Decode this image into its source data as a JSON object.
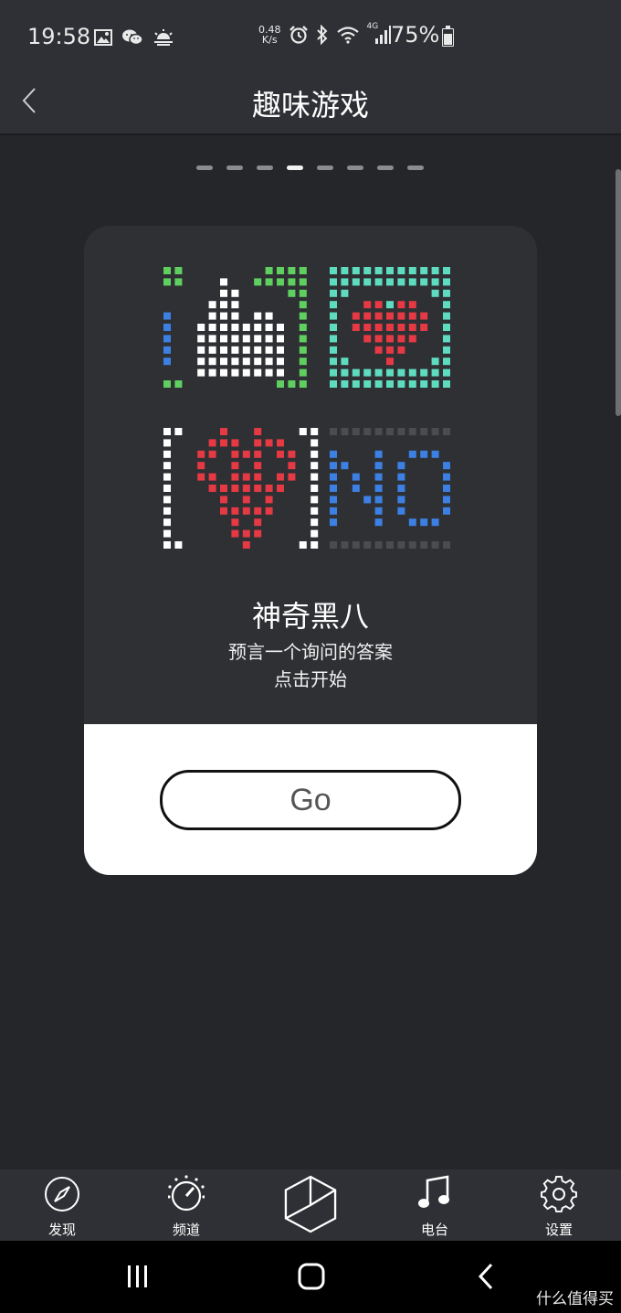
{
  "status_bar": {
    "time": "19:58",
    "net_speed_value": "0.48",
    "net_speed_unit": "K/s",
    "network_type": "4G",
    "battery": "75%",
    "left_icons": [
      "image-icon",
      "wechat-icon",
      "weather-icon"
    ],
    "right_icons": [
      "alarm-icon",
      "bluetooth-icon",
      "wifi-icon",
      "signal-icon",
      "battery-icon"
    ]
  },
  "header": {
    "title": "趣味游戏",
    "back_icon": "chevron-left-icon"
  },
  "pager": {
    "count": 8,
    "active_index": 3
  },
  "card": {
    "title": "神奇黑八",
    "description": "预言一个询问的答案",
    "action_hint": "点击开始",
    "go_label": "Go",
    "artwork": [
      "thumbs-up-pixel-icon",
      "heart-pixel-icon",
      "heart-bow-pixel-icon",
      "no-pixel-text"
    ],
    "artwork_colors": {
      "green": "#5fcf5f",
      "teal": "#5fdcc0",
      "red": "#e53944",
      "blue": "#3d80e4",
      "white": "#ffffff",
      "dark": "#4a4c50"
    }
  },
  "bottom_nav": {
    "items": [
      {
        "label": "发现",
        "icon": "compass-icon"
      },
      {
        "label": "频道",
        "icon": "dial-icon"
      },
      {
        "label": "",
        "icon": "cube-icon"
      },
      {
        "label": "电台",
        "icon": "music-note-icon"
      },
      {
        "label": "设置",
        "icon": "gear-icon"
      }
    ]
  },
  "system_nav": {
    "icons": [
      "recents-icon",
      "home-icon",
      "back-icon"
    ]
  },
  "watermark": "什么值得买",
  "colors": {
    "background": "#24262a",
    "bar": "#2e3035",
    "card": "#2e3034",
    "accent_white": "#ffffff"
  }
}
